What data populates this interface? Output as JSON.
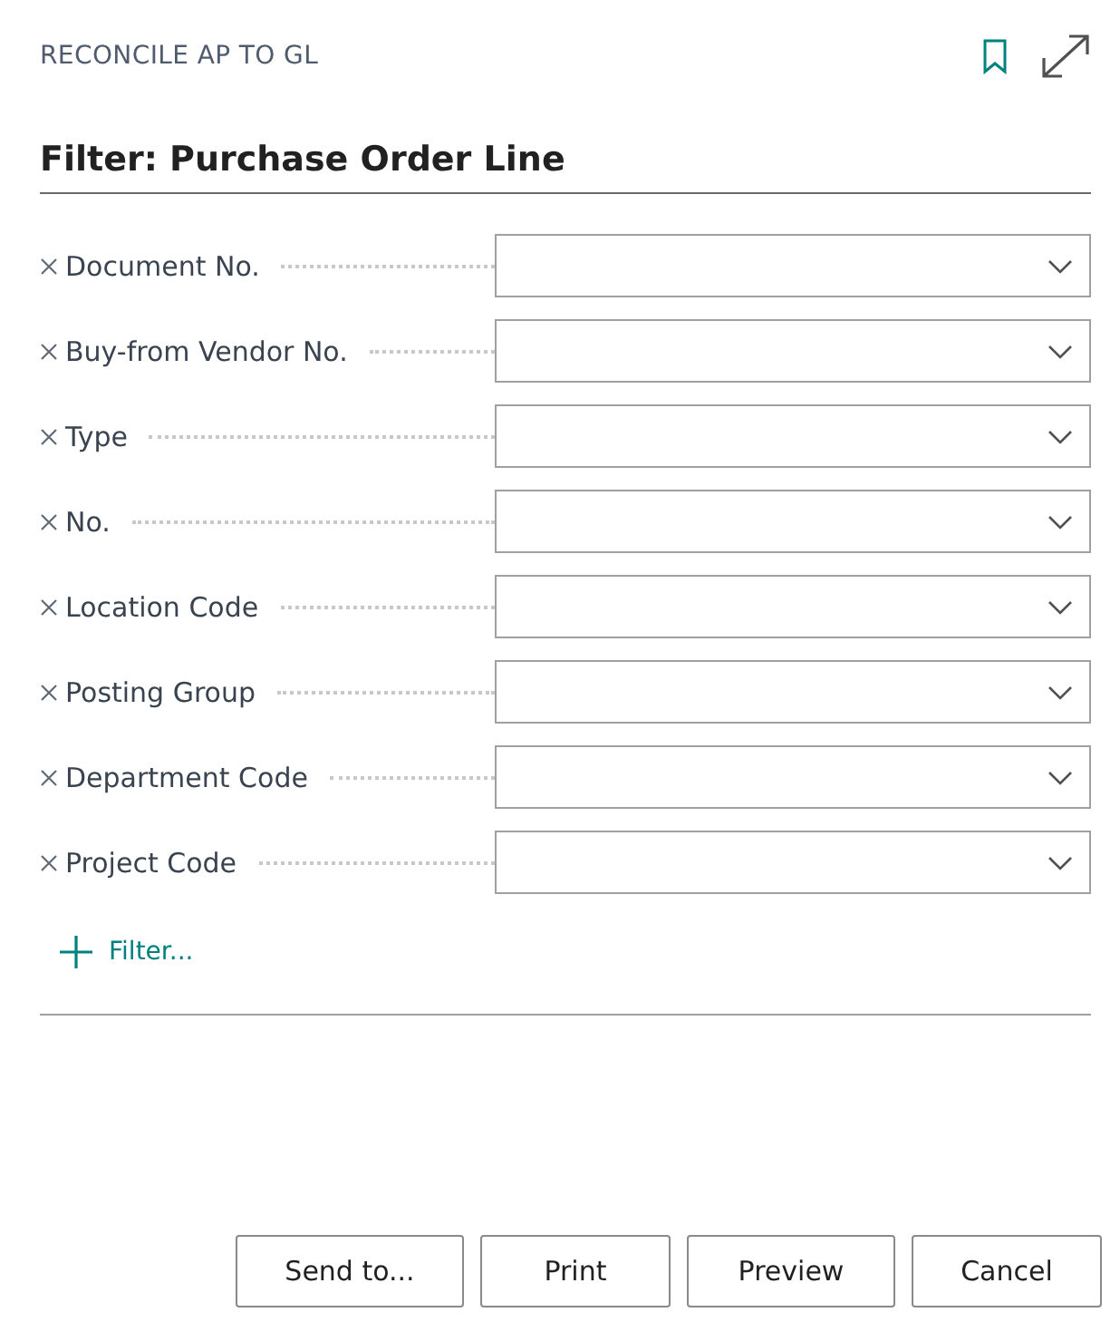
{
  "window": {
    "title": "RECONCILE AP TO GL"
  },
  "heading": "Filter: Purchase Order Line",
  "filters": [
    {
      "label": "Document No."
    },
    {
      "label": "Buy-from Vendor No."
    },
    {
      "label": "Type"
    },
    {
      "label": "No."
    },
    {
      "label": "Location Code"
    },
    {
      "label": "Posting Group"
    },
    {
      "label": "Department Code"
    },
    {
      "label": "Project Code"
    }
  ],
  "add_filter": "Filter...",
  "buttons": [
    "Send to...",
    "Print",
    "Preview",
    "Cancel"
  ]
}
